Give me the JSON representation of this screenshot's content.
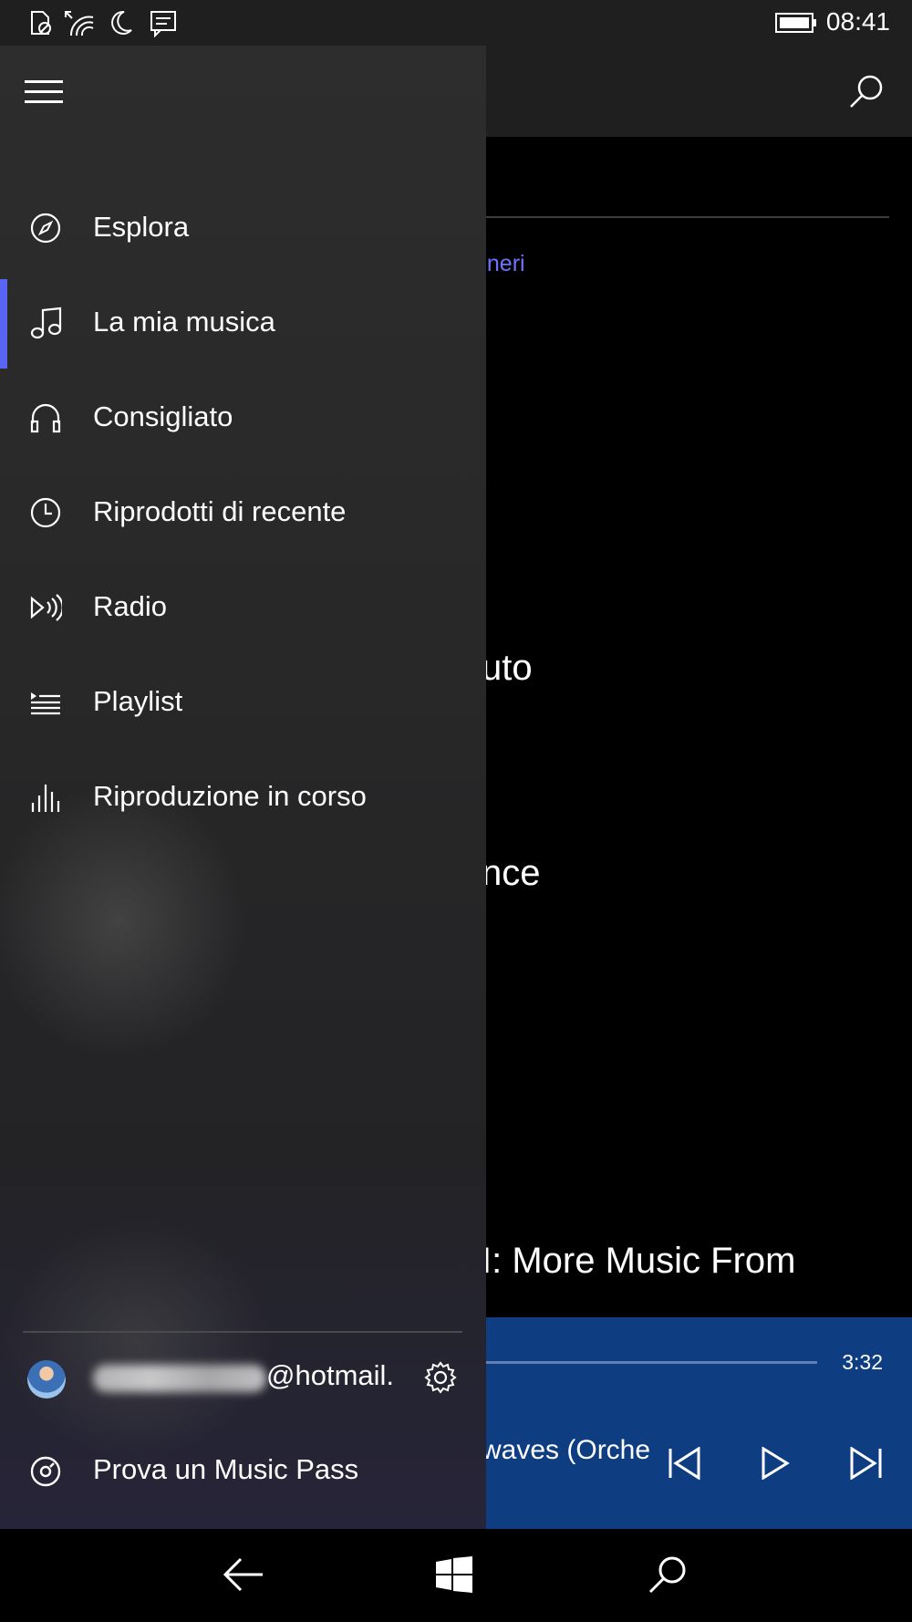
{
  "status_bar": {
    "time": "08:41",
    "icons": [
      "no-sim-icon",
      "wifi-icon",
      "quiet-hours-icon",
      "message-icon",
      "battery-icon"
    ]
  },
  "nav_pane": {
    "items": [
      {
        "label": "Esplora",
        "icon": "compass-icon",
        "active": false
      },
      {
        "label": "La mia musica",
        "icon": "music-note-icon",
        "active": true
      },
      {
        "label": "Consigliato",
        "icon": "headphones-icon",
        "active": false
      },
      {
        "label": "Riprodotti di recente",
        "icon": "clock-icon",
        "active": false
      },
      {
        "label": "Radio",
        "icon": "radio-icon",
        "active": false
      },
      {
        "label": "Playlist",
        "icon": "playlist-icon",
        "active": false
      },
      {
        "label": "Riproduzione in corso",
        "icon": "now-playing-icon",
        "active": false
      }
    ],
    "account": {
      "email_suffix": "@hotmail."
    },
    "music_pass": {
      "label": "Prova un Music Pass",
      "icon": "music-pass-icon"
    }
  },
  "background": {
    "link_text": "eneri",
    "text_1": "uto",
    "text_2": "nce",
    "text_3": "I: More Music From"
  },
  "player": {
    "time": "3:32",
    "title": "waves (Orche"
  },
  "colors": {
    "accent": "#5865f2",
    "link": "#6d74ff",
    "player_bg": "#0f3d82",
    "pane_bg": "#2b2b2b"
  }
}
